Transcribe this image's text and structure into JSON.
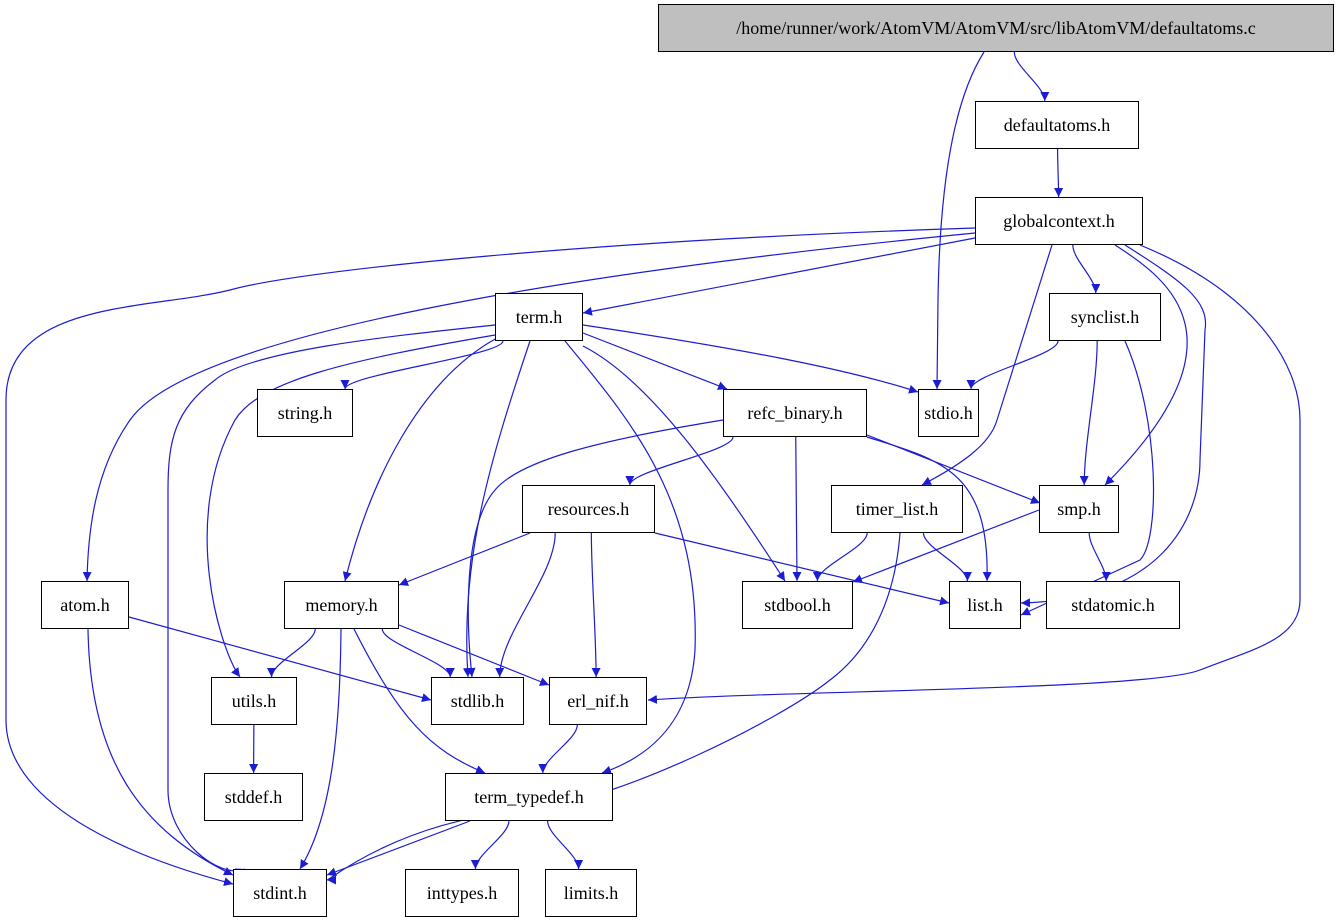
{
  "graph": {
    "type": "include-dependency-graph",
    "edge_color": "#1c1cd0",
    "root_fill": "#bfbfbf",
    "nodes": {
      "root": "/home/runner/work/AtomVM/AtomVM/src/libAtomVM/defaultatoms.c",
      "defaultatoms": "defaultatoms.h",
      "globalcontext": "globalcontext.h",
      "term": "term.h",
      "synclist": "synclist.h",
      "string": "string.h",
      "stdio": "stdio.h",
      "refc_binary": "refc_binary.h",
      "resources": "resources.h",
      "timer_list": "timer_list.h",
      "smp": "smp.h",
      "atom": "atom.h",
      "memory": "memory.h",
      "stdbool": "stdbool.h",
      "list": "list.h",
      "stdatomic": "stdatomic.h",
      "utils": "utils.h",
      "stdlib": "stdlib.h",
      "erl_nif": "erl_nif.h",
      "stddef": "stddef.h",
      "term_typedef": "term_typedef.h",
      "stdint": "stdint.h",
      "inttypes": "inttypes.h",
      "limits": "limits.h"
    },
    "edges": [
      [
        "root",
        "stdio"
      ],
      [
        "root",
        "defaultatoms"
      ],
      [
        "defaultatoms",
        "globalcontext"
      ],
      [
        "globalcontext",
        "term"
      ],
      [
        "globalcontext",
        "atom"
      ],
      [
        "globalcontext",
        "stdint"
      ],
      [
        "globalcontext",
        "timer_list"
      ],
      [
        "globalcontext",
        "synclist"
      ],
      [
        "globalcontext",
        "smp"
      ],
      [
        "globalcontext",
        "list"
      ],
      [
        "globalcontext",
        "erl_nif"
      ],
      [
        "term",
        "string"
      ],
      [
        "term",
        "stdio"
      ],
      [
        "term",
        "refc_binary"
      ],
      [
        "term",
        "memory"
      ],
      [
        "term",
        "utils"
      ],
      [
        "term",
        "stdint"
      ],
      [
        "term",
        "stdlib"
      ],
      [
        "term",
        "term_typedef"
      ],
      [
        "term",
        "stdbool"
      ],
      [
        "synclist",
        "stdio"
      ],
      [
        "synclist",
        "smp"
      ],
      [
        "synclist",
        "list"
      ],
      [
        "refc_binary",
        "resources"
      ],
      [
        "refc_binary",
        "stdlib"
      ],
      [
        "refc_binary",
        "stdbool"
      ],
      [
        "refc_binary",
        "smp"
      ],
      [
        "refc_binary",
        "list"
      ],
      [
        "resources",
        "memory"
      ],
      [
        "resources",
        "stdlib"
      ],
      [
        "resources",
        "erl_nif"
      ],
      [
        "resources",
        "list"
      ],
      [
        "timer_list",
        "stdbool"
      ],
      [
        "timer_list",
        "list"
      ],
      [
        "timer_list",
        "stdint"
      ],
      [
        "smp",
        "stdbool"
      ],
      [
        "smp",
        "stdatomic"
      ],
      [
        "atom",
        "stdlib"
      ],
      [
        "atom",
        "stdint"
      ],
      [
        "memory",
        "utils"
      ],
      [
        "memory",
        "stdlib"
      ],
      [
        "memory",
        "erl_nif"
      ],
      [
        "memory",
        "term_typedef"
      ],
      [
        "memory",
        "stdint"
      ],
      [
        "utils",
        "stddef"
      ],
      [
        "erl_nif",
        "term_typedef"
      ],
      [
        "term_typedef",
        "stdint"
      ],
      [
        "term_typedef",
        "inttypes"
      ],
      [
        "term_typedef",
        "limits"
      ]
    ]
  }
}
